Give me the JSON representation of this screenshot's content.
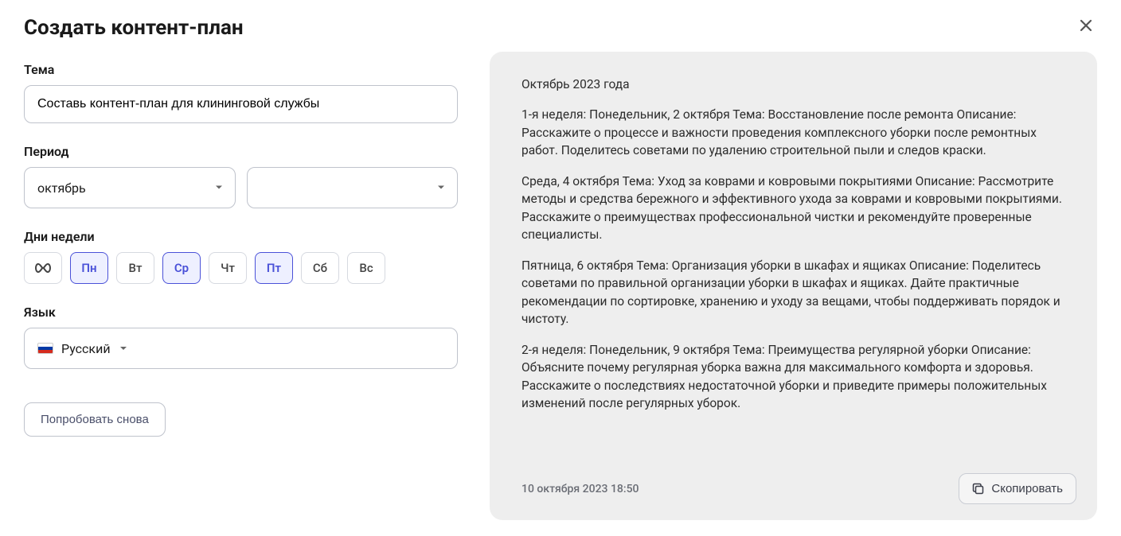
{
  "modal": {
    "title": "Создать контент-план"
  },
  "form": {
    "topic_label": "Тема",
    "topic_value": "Составь контент-план для клининговой службы",
    "period_label": "Период",
    "period_month_value": "октябрь",
    "period_year_value": "",
    "days_label": "Дни недели",
    "days": [
      {
        "label": "∞",
        "selected": false,
        "key": "all"
      },
      {
        "label": "Пн",
        "selected": true,
        "key": "mon"
      },
      {
        "label": "Вт",
        "selected": false,
        "key": "tue"
      },
      {
        "label": "Ср",
        "selected": true,
        "key": "wed"
      },
      {
        "label": "Чт",
        "selected": false,
        "key": "thu"
      },
      {
        "label": "Пт",
        "selected": true,
        "key": "fri"
      },
      {
        "label": "Сб",
        "selected": false,
        "key": "sat"
      },
      {
        "label": "Вс",
        "selected": false,
        "key": "sun"
      }
    ],
    "language_label": "Язык",
    "language_value": "Русский",
    "retry_label": "Попробовать снова"
  },
  "output": {
    "paragraphs": [
      "Октябрь 2023 года",
      "1-я неделя: Понедельник, 2 октября Тема: Восстановление после ремонта Описание: Расскажите о процессе и важности проведения комплексного уборки после ремонтных работ. Поделитесь советами по удалению строительной пыли и следов краски.",
      "Среда, 4 октября Тема: Уход за коврами и ковровыми покрытиями Описание: Рассмотрите методы и средства бережного и эффективного ухода за коврами и ковровыми покрытиями. Расскажите о преимуществах профессиональной чистки и рекомендуйте проверенные специалисты.",
      "Пятница, 6 октября Тема: Организация уборки в шкафах и ящиках Описание: Поделитесь советами по правильной организации уборки в шкафах и ящиках. Дайте практичные рекомендации по сортировке, хранению и уходу за вещами, чтобы поддерживать порядок и чистоту.",
      "2-я неделя: Понедельник, 9 октября Тема: Преимущества регулярной уборки Описание: Объясните почему регулярная уборка важна для максимального комфорта и здоровья. Расскажите о последствиях недостаточной уборки и приведите примеры положительных изменений после регулярных уборок."
    ],
    "timestamp": "10 октября 2023 18:50",
    "copy_label": "Скопировать"
  }
}
